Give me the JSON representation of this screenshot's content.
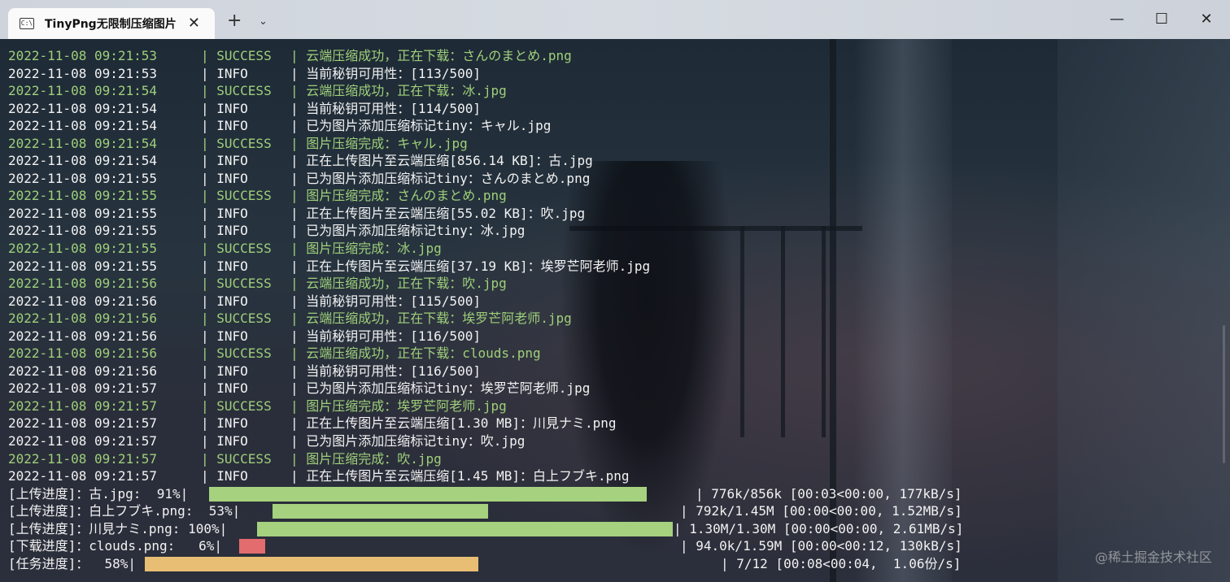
{
  "window": {
    "tab_title": "TinyPng无限制压缩图片",
    "tab_icon": "terminal-icon",
    "close_tab": "✕",
    "new_tab": "+",
    "dropdown": "⌄",
    "minimize": "—",
    "maximize": "☐",
    "close": "✕"
  },
  "log": [
    {
      "ts": "2022-11-08 09:21:53",
      "level": "SUCCESS",
      "msg": "云端压缩成功，正在下载：さんのまとめ.png"
    },
    {
      "ts": "2022-11-08 09:21:53",
      "level": "INFO",
      "msg": "当前秘钥可用性：[113/500]"
    },
    {
      "ts": "2022-11-08 09:21:54",
      "level": "SUCCESS",
      "msg": "云端压缩成功，正在下载：冰.jpg"
    },
    {
      "ts": "2022-11-08 09:21:54",
      "level": "INFO",
      "msg": "当前秘钥可用性：[114/500]"
    },
    {
      "ts": "2022-11-08 09:21:54",
      "level": "INFO",
      "msg": "已为图片添加压缩标记tiny：キャル.jpg"
    },
    {
      "ts": "2022-11-08 09:21:54",
      "level": "SUCCESS",
      "msg": "图片压缩完成：キャル.jpg"
    },
    {
      "ts": "2022-11-08 09:21:54",
      "level": "INFO",
      "msg": "正在上传图片至云端压缩[856.14 KB]：古.jpg"
    },
    {
      "ts": "2022-11-08 09:21:55",
      "level": "INFO",
      "msg": "已为图片添加压缩标记tiny：さんのまとめ.png"
    },
    {
      "ts": "2022-11-08 09:21:55",
      "level": "SUCCESS",
      "msg": "图片压缩完成：さんのまとめ.png"
    },
    {
      "ts": "2022-11-08 09:21:55",
      "level": "INFO",
      "msg": "正在上传图片至云端压缩[55.02 KB]：吹.jpg"
    },
    {
      "ts": "2022-11-08 09:21:55",
      "level": "INFO",
      "msg": "已为图片添加压缩标记tiny：冰.jpg"
    },
    {
      "ts": "2022-11-08 09:21:55",
      "level": "SUCCESS",
      "msg": "图片压缩完成：冰.jpg"
    },
    {
      "ts": "2022-11-08 09:21:55",
      "level": "INFO",
      "msg": "正在上传图片至云端压缩[37.19 KB]：埃罗芒阿老师.jpg"
    },
    {
      "ts": "2022-11-08 09:21:56",
      "level": "SUCCESS",
      "msg": "云端压缩成功，正在下载：吹.jpg"
    },
    {
      "ts": "2022-11-08 09:21:56",
      "level": "INFO",
      "msg": "当前秘钥可用性：[115/500]"
    },
    {
      "ts": "2022-11-08 09:21:56",
      "level": "SUCCESS",
      "msg": "云端压缩成功，正在下载：埃罗芒阿老师.jpg"
    },
    {
      "ts": "2022-11-08 09:21:56",
      "level": "INFO",
      "msg": "当前秘钥可用性：[116/500]"
    },
    {
      "ts": "2022-11-08 09:21:56",
      "level": "SUCCESS",
      "msg": "云端压缩成功，正在下载：clouds.png"
    },
    {
      "ts": "2022-11-08 09:21:56",
      "level": "INFO",
      "msg": "当前秘钥可用性：[116/500]"
    },
    {
      "ts": "2022-11-08 09:21:57",
      "level": "INFO",
      "msg": "已为图片添加压缩标记tiny：埃罗芒阿老师.jpg"
    },
    {
      "ts": "2022-11-08 09:21:57",
      "level": "SUCCESS",
      "msg": "图片压缩完成：埃罗芒阿老师.jpg"
    },
    {
      "ts": "2022-11-08 09:21:57",
      "level": "INFO",
      "msg": "正在上传图片至云端压缩[1.30 MB]：川見ナミ.png"
    },
    {
      "ts": "2022-11-08 09:21:57",
      "level": "INFO",
      "msg": "已为图片添加压缩标记tiny：吹.jpg"
    },
    {
      "ts": "2022-11-08 09:21:57",
      "level": "SUCCESS",
      "msg": "图片压缩完成：吹.jpg"
    },
    {
      "ts": "2022-11-08 09:21:57",
      "level": "INFO",
      "msg": "正在上传图片至云端压缩[1.45 MB]：白上フブキ.png"
    }
  ],
  "progress": [
    {
      "label": "[上传进度]：古.jpg:  91%|",
      "fraction": 0.91,
      "color": "green",
      "stats": "| 776k/856k [00:03<00:00, 177kB/s]"
    },
    {
      "label": "[上传进度]：白上フブキ.png:  53%|",
      "fraction": 0.53,
      "color": "green",
      "stats": "| 792k/1.45M [00:00<00:00, 1.52MB/s]"
    },
    {
      "label": "[上传进度]：川見ナミ.png: 100%|",
      "fraction": 1.0,
      "color": "green",
      "stats": "| 1.30M/1.30M [00:00<00:00, 2.61MB/s]"
    },
    {
      "label": "[下载进度]：clouds.png:   6%|",
      "fraction": 0.06,
      "color": "red",
      "stats": "| 94.0k/1.59M [00:00<00:12, 130kB/s]"
    },
    {
      "label": "[任务进度]：  58%|",
      "fraction": 0.58,
      "color": "orange",
      "stats": "| 7/12 [00:08<00:04,  1.06份/s]"
    }
  ],
  "watermark": "@稀土掘金技术社区",
  "colors": {
    "success": "#9fcf7a",
    "info": "#f2f2f2",
    "bar_green": "#a6d17f",
    "bar_red": "#e36c6e",
    "bar_orange": "#e8be74"
  }
}
